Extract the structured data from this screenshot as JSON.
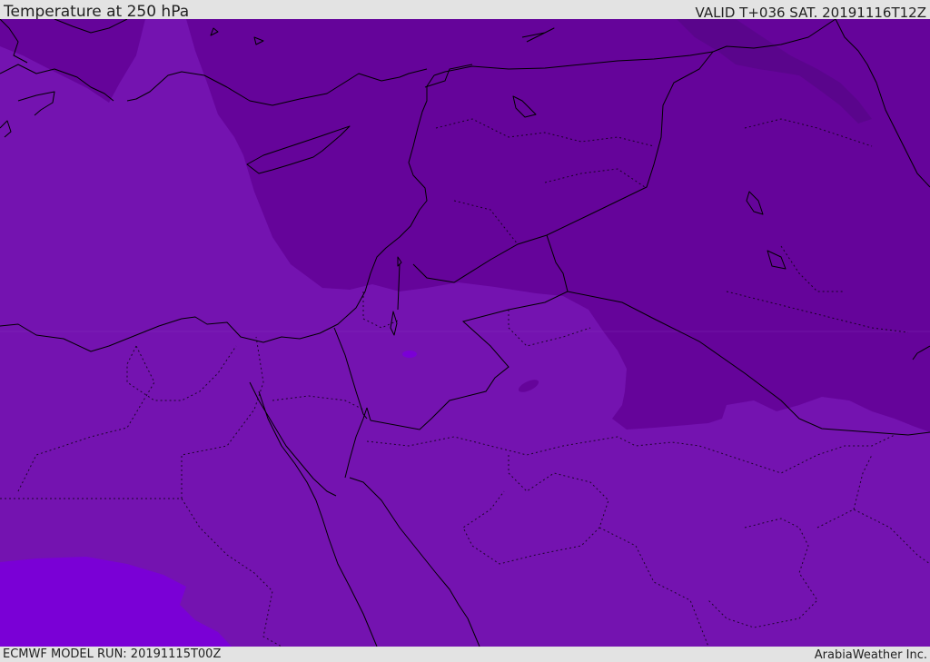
{
  "header": {
    "title": "Temperature at 250 hPa",
    "valid": "VALID T+036 SAT. 20191116T12Z"
  },
  "footer": {
    "model_run": "ECMWF MODEL RUN: 20191115T00Z",
    "credit": "ArabiaWeather Inc."
  },
  "map": {
    "field": "temperature",
    "level": "250 hPa",
    "colors": {
      "base": "#7413b0",
      "cold": "#65049a",
      "colder": "#5a058c",
      "warm_patch": "#7a00d6",
      "coast": "#000000"
    },
    "region_icon": "map-icon"
  }
}
